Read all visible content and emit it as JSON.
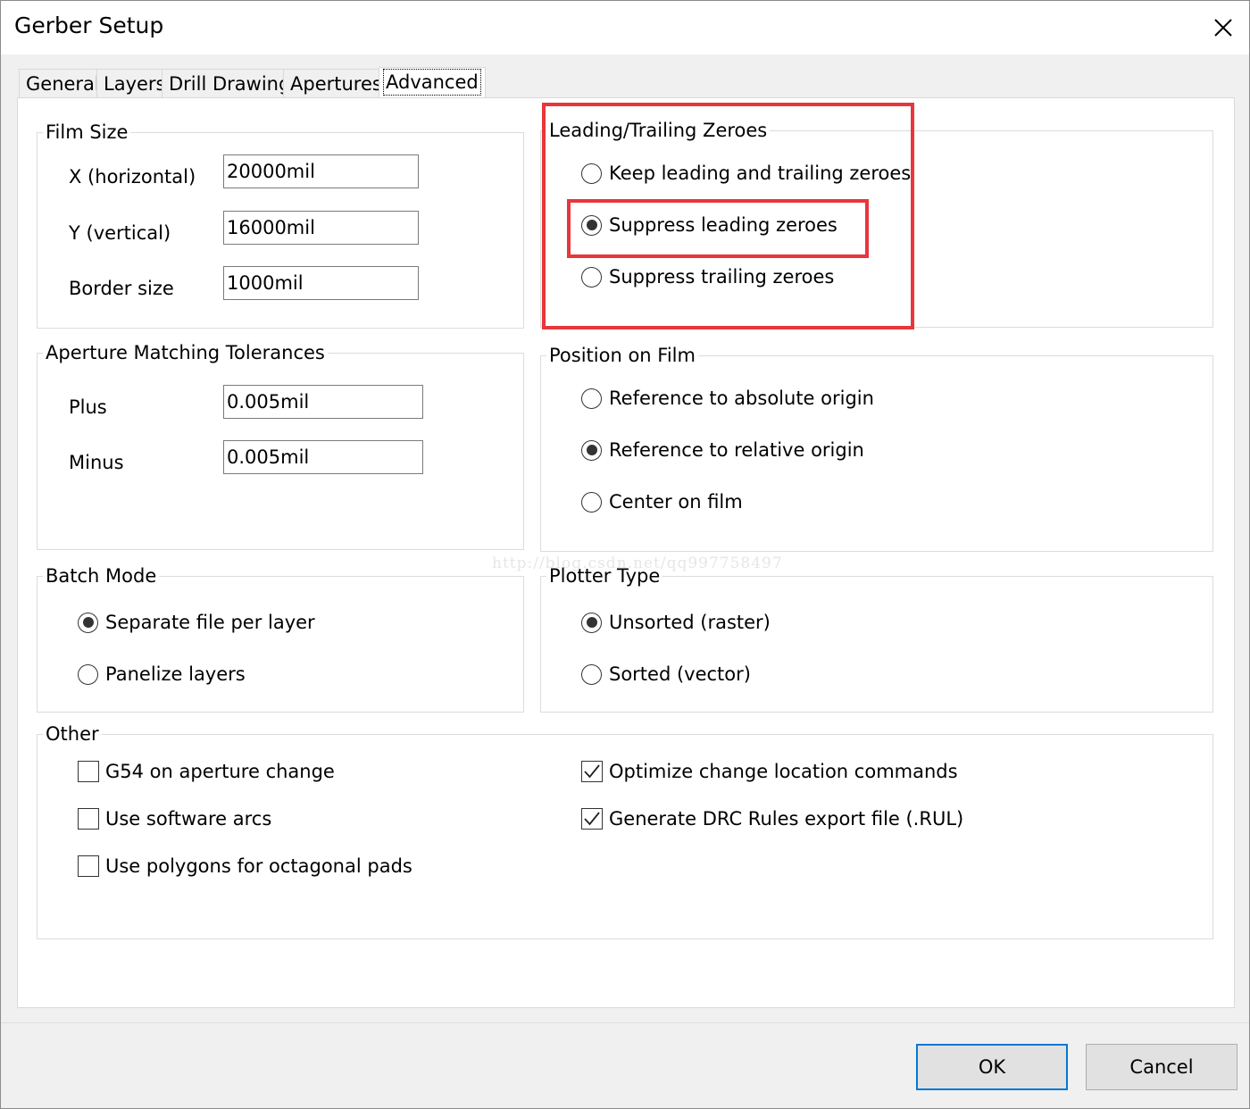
{
  "window": {
    "title": "Gerber Setup"
  },
  "tabs": [
    {
      "label": "General"
    },
    {
      "label": "Layers"
    },
    {
      "label": "Drill Drawing"
    },
    {
      "label": "Apertures"
    },
    {
      "label": "Advanced"
    }
  ],
  "active_tab": "Advanced",
  "film_size": {
    "title": "Film Size",
    "x_label": "X (horizontal)",
    "x_value": "20000mil",
    "y_label": "Y (vertical)",
    "y_value": "16000mil",
    "border_label": "Border size",
    "border_value": "1000mil"
  },
  "aperture_tolerances": {
    "title": "Aperture Matching Tolerances",
    "plus_label": "Plus",
    "plus_value": "0.005mil",
    "minus_label": "Minus",
    "minus_value": "0.005mil"
  },
  "zeroes": {
    "title": "Leading/Trailing Zeroes",
    "options": [
      {
        "label": "Keep leading and trailing zeroes",
        "selected": false
      },
      {
        "label": "Suppress leading zeroes",
        "selected": true
      },
      {
        "label": "Suppress trailing zeroes",
        "selected": false
      }
    ]
  },
  "position": {
    "title": "Position on Film",
    "options": [
      {
        "label": "Reference to absolute origin",
        "selected": false
      },
      {
        "label": "Reference to relative origin",
        "selected": true
      },
      {
        "label": "Center on film",
        "selected": false
      }
    ]
  },
  "batch": {
    "title": "Batch Mode",
    "options": [
      {
        "label": "Separate file per layer",
        "selected": true
      },
      {
        "label": "Panelize layers",
        "selected": false
      }
    ]
  },
  "plotter": {
    "title": "Plotter Type",
    "options": [
      {
        "label": "Unsorted (raster)",
        "selected": true
      },
      {
        "label": "Sorted (vector)",
        "selected": false
      }
    ]
  },
  "other": {
    "title": "Other",
    "options": [
      {
        "label": "G54 on aperture change",
        "checked": false
      },
      {
        "label": "Use software arcs",
        "checked": false
      },
      {
        "label": "Use polygons for octagonal pads",
        "checked": false
      },
      {
        "label": "Optimize change location commands",
        "checked": true
      },
      {
        "label": "Generate DRC Rules export file (.RUL)",
        "checked": true
      }
    ]
  },
  "watermark": "http://blog.csdn.net/qq997758497",
  "buttons": {
    "ok": "OK",
    "cancel": "Cancel"
  },
  "colors": {
    "highlight": "#e8363b",
    "default_button_border": "#0078d7"
  }
}
